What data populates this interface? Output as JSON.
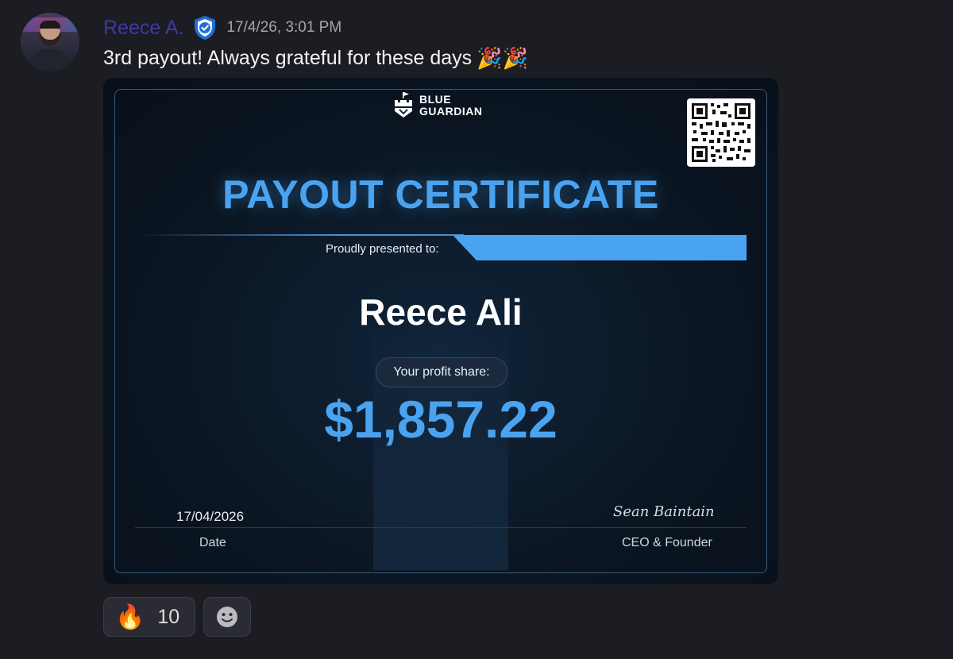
{
  "message": {
    "author": "Reece A.",
    "timestamp": "17/4/26, 3:01 PM",
    "text": "3rd payout! Always grateful for these days",
    "emojis": "🎉🎉",
    "avatar_icon": "avatar",
    "badge_icon": "verified-shield-icon",
    "username_color": "#3d3aa8"
  },
  "certificate": {
    "logo_line1": "BLUE",
    "logo_line2": "GUARDIAN",
    "title": "PAYOUT CERTIFICATE",
    "presented_label": "Proudly presented to:",
    "recipient": "Reece Ali",
    "profit_label": "Your profit share:",
    "amount": "$1,857.22",
    "date_value": "17/04/2026",
    "date_label": "Date",
    "signature": "Sean Baintain",
    "signer_label": "CEO & Founder",
    "accent_color": "#4aa3f0"
  },
  "reactions": [
    {
      "emoji": "🔥",
      "count": "10"
    }
  ],
  "add_reaction_icon": "smiley-icon"
}
